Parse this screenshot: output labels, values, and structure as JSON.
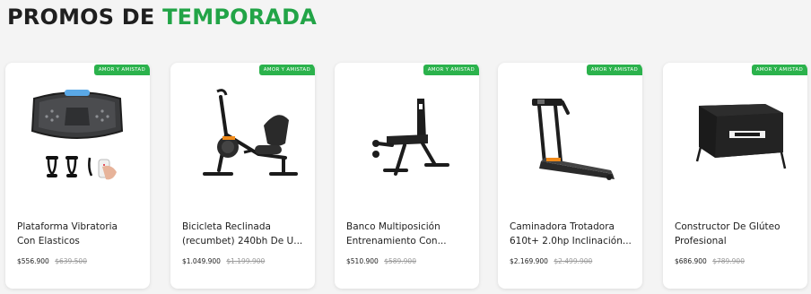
{
  "section": {
    "title_part1": "PROMOS DE",
    "title_part2": "TEMPORADA",
    "accent_color": "#22a447"
  },
  "products": [
    {
      "badge": "AMOR Y AMISTAD",
      "name_line1": "Plataforma Vibratoria",
      "name_line2": "Con Elasticos",
      "price": "$556.900",
      "old_price": "$639.500",
      "icon": "vibration-platform-image"
    },
    {
      "badge": "AMOR Y AMISTAD",
      "name_line1": "Bicicleta Reclinada",
      "name_line2": "(recumbet) 240bh De U...",
      "price": "$1.049.900",
      "old_price": "$1.199.900",
      "icon": "recumbent-bike-image"
    },
    {
      "badge": "AMOR Y AMISTAD",
      "name_line1": "Banco Multiposición",
      "name_line2": "Entrenamiento Con...",
      "price": "$510.900",
      "old_price": "$589.900",
      "icon": "workout-bench-image"
    },
    {
      "badge": "AMOR Y AMISTAD",
      "name_line1": "Caminadora Trotadora",
      "name_line2": "610t+ 2.0hp Inclinación...",
      "price": "$2.169.900",
      "old_price": "$2.499.900",
      "icon": "treadmill-image"
    },
    {
      "badge": "AMOR Y AMISTAD",
      "name_line1": "Constructor De Glúteo",
      "name_line2": "Profesional",
      "price": "$686.900",
      "old_price": "$789.900",
      "icon": "glute-builder-image"
    }
  ]
}
